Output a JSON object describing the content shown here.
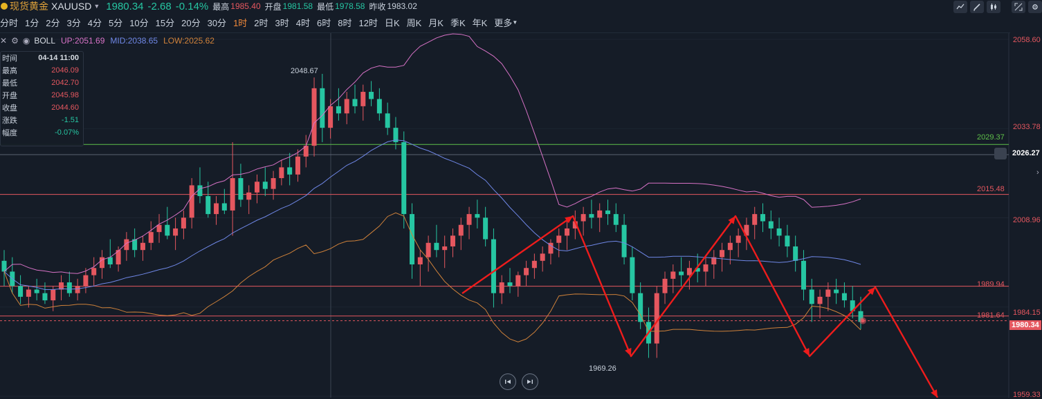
{
  "header": {
    "name": "现货黄金",
    "code": "XAUUSD",
    "price": "1980.34",
    "change": "-2.68",
    "change_pct": "-0.14%",
    "high_label": "最高",
    "high": "1985.40",
    "open_label": "开盘",
    "open": "1981.58",
    "low_label": "最低",
    "low": "1978.58",
    "prev_label": "昨收",
    "prev": "1983.02"
  },
  "intervals": [
    "分时",
    "1分",
    "2分",
    "3分",
    "4分",
    "5分",
    "10分",
    "15分",
    "20分",
    "30分",
    "1时",
    "2时",
    "3时",
    "4时",
    "6时",
    "8时",
    "12时",
    "日K",
    "周K",
    "月K",
    "季K",
    "年K",
    "更多"
  ],
  "active_interval": "1时",
  "indicator": {
    "name": "BOLL",
    "up": "UP:2051.69",
    "mid": "MID:2038.65",
    "low": "LOW:2025.62"
  },
  "tooltip": {
    "time_label": "时间",
    "time": "04-14 11:00",
    "high_label": "最高",
    "high": "2046.09",
    "low_label": "最低",
    "low": "2042.70",
    "open_label": "开盘",
    "open": "2045.98",
    "close_label": "收盘",
    "close": "2044.60",
    "chg_label": "涨跌",
    "chg": "-1.51",
    "amp_label": "幅度",
    "amp": "-0.07%"
  },
  "axis": {
    "labels": [
      "2058.60",
      "2033.78",
      "2008.96",
      "1984.15",
      "1959.33"
    ],
    "crosshair_price": "2026.27",
    "last_price": "1980.34"
  },
  "levels": [
    {
      "value": "2029.37",
      "color": "#5fc04a"
    },
    {
      "value": "2015.48",
      "color": "#e5575f"
    },
    {
      "value": "1989.94",
      "color": "#e5575f"
    },
    {
      "value": "1981.64",
      "color": "#e5575f"
    }
  ],
  "annotations": {
    "hi": "2048.67",
    "lo": "1969.26"
  },
  "colors": {
    "up": "#e5575f",
    "down": "#26c6a2",
    "band_up": "#d772c6",
    "band_mid": "#6f87e6",
    "band_low": "#d0823a",
    "arrow": "#ee1c1c"
  },
  "chart_data": {
    "type": "candlestick",
    "price_range": [
      1959.33,
      2058.6
    ],
    "candles": [
      [
        1997,
        2000,
        1990,
        1994
      ],
      [
        1994,
        1998,
        1988,
        1990
      ],
      [
        1990,
        1993,
        1985,
        1987
      ],
      [
        1987,
        1990,
        1984,
        1989
      ],
      [
        1989,
        1992,
        1986,
        1988
      ],
      [
        1988,
        1991,
        1985,
        1986
      ],
      [
        1986,
        1990,
        1983,
        1989
      ],
      [
        1989,
        1993,
        1986,
        1991
      ],
      [
        1991,
        1994,
        1987,
        1988
      ],
      [
        1988,
        1992,
        1986,
        1990
      ],
      [
        1990,
        1995,
        1988,
        1993
      ],
      [
        1993,
        1998,
        1990,
        1995
      ],
      [
        1995,
        2000,
        1992,
        1998
      ],
      [
        1998,
        2003,
        1995,
        1996
      ],
      [
        1996,
        2001,
        1994,
        2000
      ],
      [
        2000,
        2005,
        1997,
        2003
      ],
      [
        2003,
        2006,
        1998,
        2000
      ],
      [
        2000,
        2004,
        1997,
        2002
      ],
      [
        2002,
        2008,
        2000,
        2005
      ],
      [
        2005,
        2010,
        2002,
        2007
      ],
      [
        2007,
        2012,
        2003,
        2004
      ],
      [
        2004,
        2009,
        2000,
        2006
      ],
      [
        2006,
        2011,
        2003,
        2009
      ],
      [
        2009,
        2020,
        2006,
        2018
      ],
      [
        2018,
        2023,
        2013,
        2015
      ],
      [
        2015,
        2019,
        2009,
        2010
      ],
      [
        2010,
        2015,
        2007,
        2013
      ],
      [
        2013,
        2017,
        2010,
        2011
      ],
      [
        2011,
        2030,
        2004,
        2020
      ],
      [
        2020,
        2024,
        2012,
        2014
      ],
      [
        2014,
        2018,
        2010,
        2016
      ],
      [
        2016,
        2021,
        2013,
        2019
      ],
      [
        2019,
        2023,
        2015,
        2017
      ],
      [
        2017,
        2022,
        2014,
        2020
      ],
      [
        2020,
        2025,
        2018,
        2023
      ],
      [
        2023,
        2027,
        2018,
        2021
      ],
      [
        2021,
        2028,
        2019,
        2026
      ],
      [
        2026,
        2032,
        2023,
        2029
      ],
      [
        2029,
        2048,
        2026,
        2045
      ],
      [
        2045,
        2049,
        2030,
        2034
      ],
      [
        2034,
        2042,
        2031,
        2040
      ],
      [
        2040,
        2045,
        2036,
        2038
      ],
      [
        2038,
        2044,
        2035,
        2042
      ],
      [
        2042,
        2046,
        2038,
        2040
      ],
      [
        2040,
        2046,
        2036,
        2044
      ],
      [
        2044,
        2047,
        2040,
        2042
      ],
      [
        2042,
        2045,
        2036,
        2038
      ],
      [
        2038,
        2041,
        2032,
        2034
      ],
      [
        2034,
        2037,
        2028,
        2030
      ],
      [
        2030,
        2033,
        2006,
        2010
      ],
      [
        2010,
        2013,
        1992,
        1996
      ],
      [
        1996,
        2000,
        1990,
        1998
      ],
      [
        1998,
        2004,
        1994,
        2002
      ],
      [
        2002,
        2007,
        1998,
        2000
      ],
      [
        2000,
        2004,
        1995,
        2001
      ],
      [
        2001,
        2006,
        1998,
        2004
      ],
      [
        2004,
        2009,
        2000,
        2007
      ],
      [
        2007,
        2012,
        2003,
        2010
      ],
      [
        2010,
        2014,
        2006,
        2009
      ],
      [
        2009,
        2012,
        2001,
        2003
      ],
      [
        2003,
        2006,
        1984,
        1988
      ],
      [
        1988,
        1993,
        1985,
        1991
      ],
      [
        1991,
        1995,
        1988,
        1990
      ],
      [
        1990,
        1994,
        1987,
        1993
      ],
      [
        1993,
        1997,
        1990,
        1995
      ],
      [
        1995,
        1999,
        1992,
        1997
      ],
      [
        1997,
        2001,
        1994,
        1999
      ],
      [
        1999,
        2003,
        1996,
        2002
      ],
      [
        2002,
        2006,
        1998,
        2004
      ],
      [
        2004,
        2008,
        2000,
        2006
      ],
      [
        2006,
        2011,
        2003,
        2008
      ],
      [
        2008,
        2012,
        2004,
        2010
      ],
      [
        2010,
        2014,
        2006,
        2009
      ],
      [
        2009,
        2013,
        2005,
        2011
      ],
      [
        2011,
        2014,
        2007,
        2010
      ],
      [
        2010,
        2013,
        2005,
        2007
      ],
      [
        2007,
        2010,
        1996,
        1998
      ],
      [
        1998,
        2001,
        1986,
        1988
      ],
      [
        1988,
        1991,
        1978,
        1980
      ],
      [
        1980,
        1984,
        1970,
        1974
      ],
      [
        1974,
        1990,
        1970,
        1988
      ],
      [
        1988,
        1994,
        1985,
        1992
      ],
      [
        1992,
        1996,
        1988,
        1994
      ],
      [
        1994,
        1998,
        1990,
        1993
      ],
      [
        1993,
        1997,
        1989,
        1995
      ],
      [
        1995,
        1999,
        1991,
        1994
      ],
      [
        1994,
        1998,
        1990,
        1996
      ],
      [
        1996,
        2000,
        1992,
        1998
      ],
      [
        1998,
        2002,
        1994,
        2000
      ],
      [
        2000,
        2004,
        1996,
        2002
      ],
      [
        2002,
        2006,
        1998,
        2004
      ],
      [
        2004,
        2009,
        2000,
        2007
      ],
      [
        2007,
        2012,
        2003,
        2010
      ],
      [
        2010,
        2013,
        2005,
        2008
      ],
      [
        2008,
        2011,
        2003,
        2006
      ],
      [
        2006,
        2009,
        2001,
        2004
      ],
      [
        2004,
        2007,
        1998,
        2001
      ],
      [
        2001,
        2004,
        1994,
        1997
      ],
      [
        1997,
        2000,
        1986,
        1989
      ],
      [
        1989,
        1992,
        1980,
        1985
      ],
      [
        1985,
        1989,
        1981,
        1987
      ],
      [
        1987,
        1991,
        1983,
        1989
      ],
      [
        1989,
        1992,
        1985,
        1988
      ],
      [
        1988,
        1991,
        1984,
        1986
      ],
      [
        1986,
        1990,
        1981,
        1983
      ],
      [
        1983,
        1987,
        1978,
        1980
      ]
    ]
  }
}
